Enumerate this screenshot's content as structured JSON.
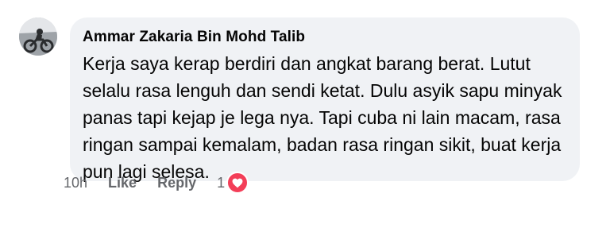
{
  "comment": {
    "author": "Ammar Zakaria Bin Mohd Talib",
    "text_lines": [
      "Kerja saya kerap berdiri dan angkat barang berat. Lutut",
      "selalu rasa lenguh dan sendi ketat. Dulu asyik sapu minyak",
      "panas tapi kejap je lega nya. Tapi cuba ni lain macam, rasa",
      "ringan sampai kemalam, badan rasa ringan sikit, buat kerja",
      "pun lagi selesa."
    ],
    "time": "10h",
    "like_label": "Like",
    "reply_label": "Reply",
    "reaction_count": "1",
    "reaction_icon": "heart-icon",
    "colors": {
      "bubble": "#f0f2f5",
      "meta": "#65676b",
      "heart": "#f33e58"
    }
  }
}
